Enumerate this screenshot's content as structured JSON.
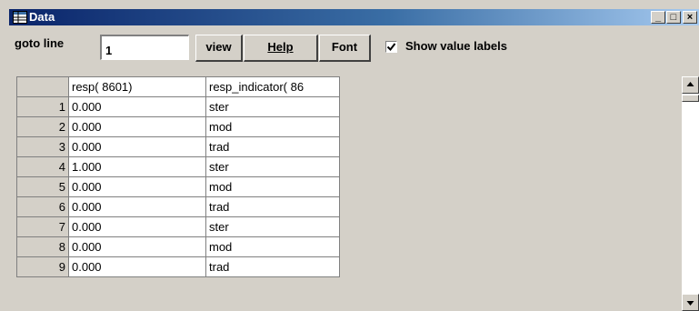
{
  "window": {
    "title": "Data",
    "minimize": "_",
    "maximize": "□",
    "close": "×"
  },
  "toolbar": {
    "goto_label": "goto line",
    "goto_value": "1",
    "view_label": "view",
    "help_label": "Help",
    "font_label": "Font",
    "show_value_labels_label": "Show value labels",
    "show_value_labels_checked": true
  },
  "grid": {
    "columns": [
      "resp( 8601)",
      "resp_indicator( 86"
    ],
    "rows": [
      {
        "n": "1",
        "resp": "0.000",
        "ind": "ster"
      },
      {
        "n": "2",
        "resp": "0.000",
        "ind": "mod"
      },
      {
        "n": "3",
        "resp": "0.000",
        "ind": "trad"
      },
      {
        "n": "4",
        "resp": "1.000",
        "ind": "ster"
      },
      {
        "n": "5",
        "resp": "0.000",
        "ind": "mod"
      },
      {
        "n": "6",
        "resp": "0.000",
        "ind": "trad"
      },
      {
        "n": "7",
        "resp": "0.000",
        "ind": "ster"
      },
      {
        "n": "8",
        "resp": "0.000",
        "ind": "mod"
      },
      {
        "n": "9",
        "resp": "0.000",
        "ind": "trad"
      }
    ]
  }
}
